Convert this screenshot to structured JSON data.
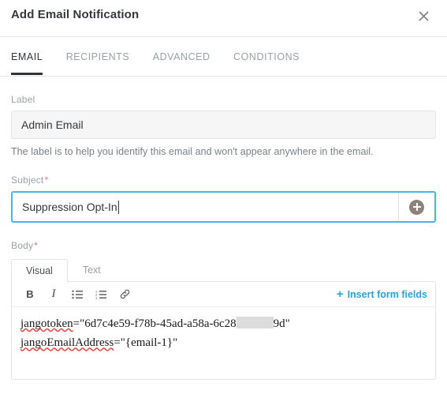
{
  "dialog": {
    "title": "Add Email Notification",
    "close_icon": "close-icon"
  },
  "tabs": [
    {
      "label": "EMAIL",
      "active": true
    },
    {
      "label": "RECIPIENTS",
      "active": false
    },
    {
      "label": "ADVANCED",
      "active": false
    },
    {
      "label": "CONDITIONS",
      "active": false
    }
  ],
  "fields": {
    "label": {
      "label": "Label",
      "value": "Admin Email",
      "placeholder": "",
      "help": "The label is to help you identify this email and won't appear anywhere in the email."
    },
    "subject": {
      "label": "Subject",
      "required_marker": "*",
      "value": "Suppression Opt-In",
      "placeholder": "",
      "add_button_icon": "plus-circle-icon"
    },
    "body": {
      "label": "Body",
      "required_marker": "*"
    }
  },
  "editor": {
    "tabs": [
      {
        "label": "Visual",
        "active": true
      },
      {
        "label": "Text",
        "active": false
      }
    ],
    "toolbar": {
      "bold": "B",
      "italic": "I",
      "bullet_list_icon": "unordered-list-icon",
      "numbered_list_icon": "ordered-list-icon",
      "link_icon": "link-icon",
      "insert_fields_plus": "+",
      "insert_fields_label": "Insert form fields"
    },
    "content": {
      "line1_prefix": "jangotoken",
      "line1_mid": "=\"6d7c4e59-f78b-45ad-a58a-6c28",
      "line1_suffix": "9d\"",
      "line2_prefix": "jangoEmailAddress",
      "line2_suffix": "=\"{email-1}\""
    }
  },
  "colors": {
    "accent_blue": "#29a3e0",
    "focus_border": "#4ab3e8",
    "required_red": "#f2776a",
    "active_tab_underline": "#2f3438",
    "text_dark": "#33383d",
    "text_muted": "#9aa0a6"
  }
}
